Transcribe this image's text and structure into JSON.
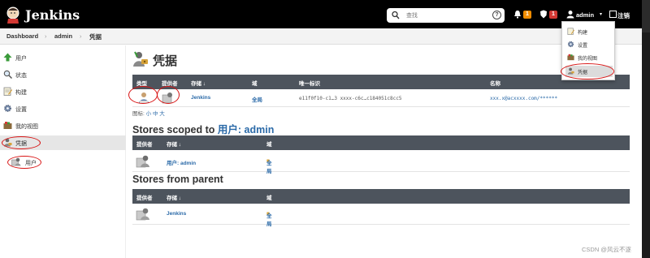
{
  "header": {
    "brand": "Jenkins",
    "search_placeholder": "查找",
    "help": "?",
    "notifications_count": "1",
    "security_count": "1",
    "user_name": "admin",
    "logout_label": "注销",
    "accent_colors": {
      "notify": "#f08c00",
      "security": "#d33833"
    }
  },
  "breadcrumb": {
    "items": [
      "Dashboard",
      "admin",
      "凭据"
    ]
  },
  "sidebar": {
    "items": [
      {
        "label": "用户",
        "icon": "up-arrow-icon"
      },
      {
        "label": "状态",
        "icon": "search-icon"
      },
      {
        "label": "构建",
        "icon": "notepad-icon"
      },
      {
        "label": "设置",
        "icon": "gear-icon"
      },
      {
        "label": "我的视图",
        "icon": "folder-icon"
      },
      {
        "label": "凭据",
        "icon": "credentials-icon"
      }
    ],
    "sub_item": {
      "label": "用户",
      "icon": "user-store-icon"
    }
  },
  "main": {
    "title": "凭据",
    "credentials_table": {
      "headers": [
        "类型",
        "提供者",
        "存储 ↓",
        "域",
        "唯一标识",
        "名称"
      ],
      "rows": [
        {
          "store": "Jenkins",
          "domain": "全局",
          "id": "e11f0f10-c1…3 xxxx-c6c…c184051c8cc5",
          "name": "xxx.x@acxxxx.com/******"
        }
      ]
    },
    "icon_size": {
      "label": "图标:",
      "small": "小",
      "medium": "中",
      "large": "大"
    },
    "scoped": {
      "title_prefix": "Stores scoped to",
      "title_link": "用户: admin",
      "headers": [
        "提供者",
        "存储 ↓",
        "域"
      ],
      "rows": [
        {
          "store": "用户: admin",
          "domain": "全局"
        }
      ]
    },
    "parent": {
      "title": "Stores from parent",
      "headers": [
        "提供者",
        "存储 ↓",
        "域"
      ],
      "rows": [
        {
          "store": "Jenkins",
          "domain": "全局"
        }
      ]
    }
  },
  "user_menu": {
    "items": [
      {
        "label": "构建",
        "icon": "notepad-icon"
      },
      {
        "label": "设置",
        "icon": "gear-icon"
      },
      {
        "label": "我的视图",
        "icon": "folder-icon"
      },
      {
        "label": "凭据",
        "icon": "credentials-icon"
      }
    ]
  },
  "watermark": "CSDN @风云不逐"
}
